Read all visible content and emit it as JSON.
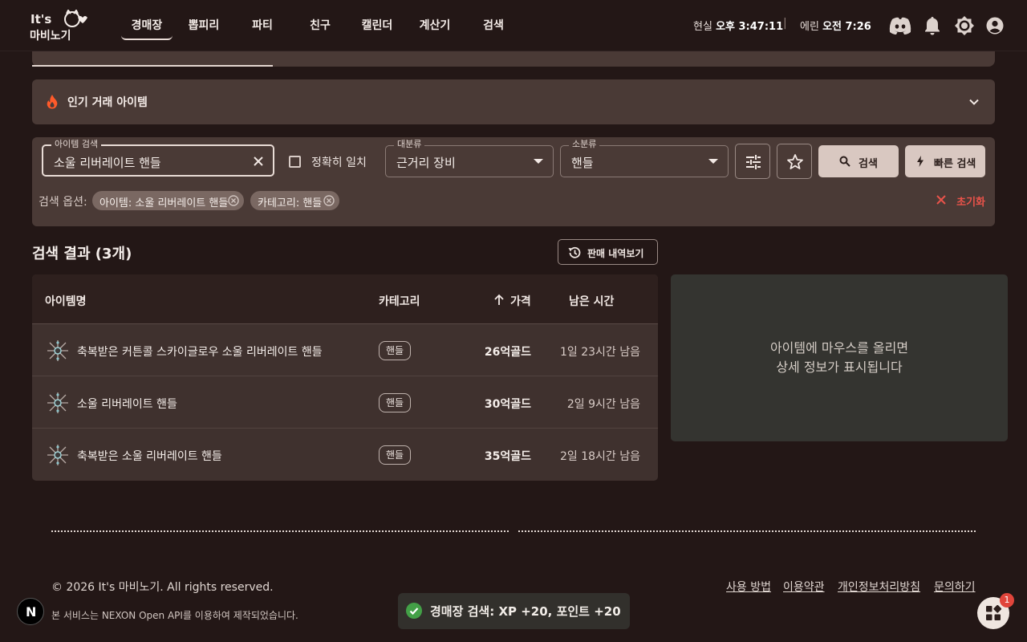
{
  "app": {
    "logo_text": "It's 마비노기"
  },
  "nav": {
    "items": [
      {
        "label": "경매장",
        "active": true
      },
      {
        "label": "뽑피리"
      },
      {
        "label": "파티"
      },
      {
        "label": "친구"
      },
      {
        "label": "캘린더"
      },
      {
        "label": "계산기"
      },
      {
        "label": "검색"
      }
    ]
  },
  "clock": {
    "real_label": "현실",
    "real_time": "오후 3:47:11",
    "separator": "|",
    "erinn_label": "에린",
    "erinn_time": "오전 7:26"
  },
  "header_icons": [
    "discord-icon",
    "bell-icon",
    "theme-toggle-icon",
    "account-icon"
  ],
  "popular": {
    "title": "인기 거래 아이템",
    "icon": "fire-icon"
  },
  "search": {
    "item_label": "아이템 검색",
    "item_value": "소울 리버레이트 핸들",
    "exact_match_label": "정확히 일치",
    "exact_match_checked": false,
    "category_label": "대분류",
    "category_value": "근거리 장비",
    "subcategory_label": "소분류",
    "subcategory_value": "핸들",
    "search_button": "검색",
    "quick_search_button": "빠른 검색",
    "options_label": "검색 옵션:",
    "chips": [
      "아이템: 소울 리버레이트 핸들",
      "카테고리: 핸들"
    ],
    "reset_label": "초기화"
  },
  "results": {
    "title": "검색 결과 (3개)",
    "history_button": "판매 내역보기",
    "columns": {
      "name": "아이템명",
      "category": "카테고리",
      "price": "가격",
      "remaining": "남은 시간"
    },
    "price_sort": "ascending",
    "rows": [
      {
        "name": "축복받은 커튼콜 스카이글로우 소울 리버레이트 핸들",
        "category": "핸들",
        "price": "26억골드",
        "remaining": "1일 23시간 남음"
      },
      {
        "name": "소울 리버레이트 핸들",
        "category": "핸들",
        "price": "30억골드",
        "remaining": "2일 9시간 남음"
      },
      {
        "name": "축복받은 소울 리버레이트 핸들",
        "category": "핸들",
        "price": "35억골드",
        "remaining": "2일 18시간 남음"
      }
    ]
  },
  "detail": {
    "line1": "아이템에 마우스를 올리면",
    "line2": "상세 정보가 표시됩니다"
  },
  "footer": {
    "copyright": "© 2026 It's 마비노기. All rights reserved.",
    "links": [
      "사용 방법",
      "이용약관",
      "개인정보처리방침",
      "문의하기"
    ],
    "note": "본 서비스는 NEXON Open API를 이용하여 제작되었습니다."
  },
  "toast": {
    "message": "경매장 검색: XP +20, 포인트 +20"
  },
  "nextjs_badge": "N",
  "fab": {
    "badge_count": "1"
  },
  "colors": {
    "background": "#231716",
    "panel": "#4a3a36",
    "accent_fire": "#ff5a2a",
    "reset": "#e9534a",
    "success": "#43a047",
    "primary_button": "#d9c8c1"
  }
}
